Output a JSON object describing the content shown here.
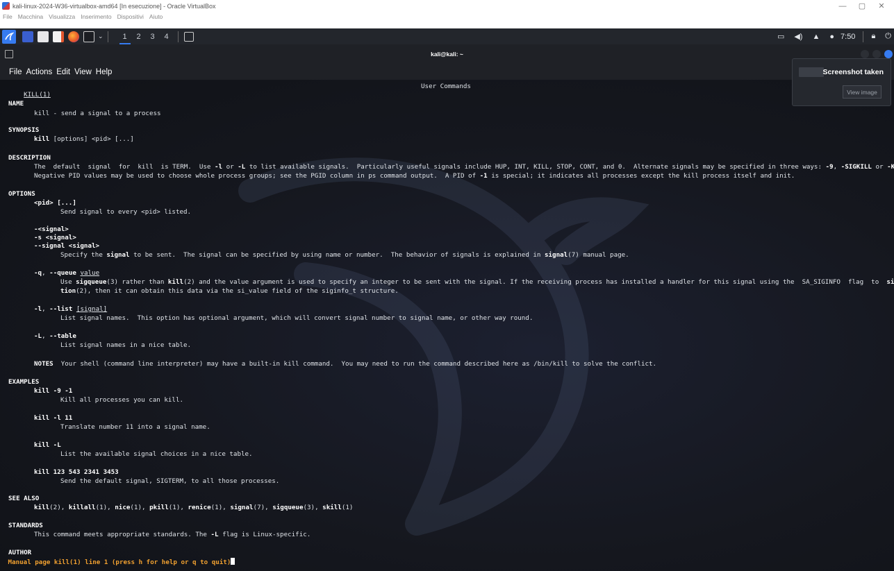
{
  "vbox": {
    "title": "kali-linux-2024-W36-virtualbox-amd64 [In esecuzione] - Oracle VirtualBox",
    "menu": [
      "File",
      "Macchina",
      "Visualizza",
      "Inserimento",
      "Dispositivi",
      "Aiuto"
    ],
    "controls": {
      "minimize": "—",
      "restore": "▢",
      "close": "✕"
    }
  },
  "panel": {
    "workspaces": [
      "1",
      "2",
      "3",
      "4"
    ],
    "active_workspace": "1",
    "clock": "7:50",
    "icons": [
      "kali-menu-icon",
      "terminal-app-icon",
      "file-manager-icon",
      "text-editor-icon",
      "firefox-icon",
      "terminal-icon",
      "window-icon",
      "display-icon",
      "volume-icon",
      "notification-bell-icon",
      "power-icon",
      "lock-icon",
      "logout-icon"
    ]
  },
  "terminal": {
    "title": "kali@kali: ~",
    "menu": [
      "File",
      "Actions",
      "Edit",
      "View",
      "Help"
    ]
  },
  "man": {
    "header_left": "KILL(1)",
    "header_center": "User Commands",
    "name_heading": "NAME",
    "name_text": "kill - send a signal to a process",
    "synopsis_heading": "SYNOPSIS",
    "synopsis_cmd": "kill",
    "synopsis_args": " [options] <pid> [...]",
    "description_heading": "DESCRIPTION",
    "desc_l1_a": "The  default  signal  for  kill  is TERM.  Use ",
    "desc_l1_b": "-l",
    "desc_l1_c": " or ",
    "desc_l1_d": "-L",
    "desc_l1_e": " to list available signals.  Particularly useful signals include HUP, INT, KILL, STOP, CONT, and 0.  Alternate signals may be specified in three ways: ",
    "desc_l1_f": "-9",
    "desc_l1_g": ", ",
    "desc_l1_h": "-SIGKILL",
    "desc_l1_i": " or ",
    "desc_l1_j": "-KILL",
    "desc_l1_k": ".",
    "desc_l2_a": "Negative PID values may be used to choose whole process groups; see the PGID column in ps command output.  A PID of ",
    "desc_l2_b": "-1",
    "desc_l2_c": " is special; it indicates all processes except the kill process itself and init.",
    "options_heading": "OPTIONS",
    "opt_pid": "<pid> [...]",
    "opt_pid_desc": "Send signal to every <pid> listed.",
    "opt_sig1": "-<signal>",
    "opt_sig2": "-s <signal>",
    "opt_sig3": "--signal <signal>",
    "opt_sig_desc_a": "Specify the ",
    "opt_sig_desc_b": "signal",
    "opt_sig_desc_c": " to be sent.  The signal can be specified by using name or number.  The behavior of signals is explained in ",
    "opt_sig_desc_d": "signal",
    "opt_sig_desc_e": "(7) manual page.",
    "opt_q_a": "-q",
    "opt_q_b": ", ",
    "opt_q_c": "--queue",
    "opt_q_d": "value",
    "opt_q_desc1_a": "Use ",
    "opt_q_desc1_b": "sigqueue",
    "opt_q_desc1_c": "(3) rather than ",
    "opt_q_desc1_d": "kill",
    "opt_q_desc1_e": "(2) and the value argument is used to specify an integer to be sent with the signal. If the receiving process has installed a handler for this signal using the  SA_SIGINFO  flag  to  ",
    "opt_q_desc1_f": "sigac-",
    "opt_q_desc2_a": "tion",
    "opt_q_desc2_b": "(2), then it can obtain this data via the si_value field of the siginfo_t structure.",
    "opt_l_a": "-l",
    "opt_l_b": ", ",
    "opt_l_c": "--list",
    "opt_l_d": "[signal]",
    "opt_l_desc": "List signal names.  This option has optional argument, which will convert signal number to signal name, or other way round.",
    "opt_L_a": "-L",
    "opt_L_b": ", ",
    "opt_L_c": "--table",
    "opt_L_desc": "List signal names in a nice table.",
    "notes_label": "NOTES",
    "notes_text": "  Your shell (command line interpreter) may have a built-in kill command.  You may need to run the command described here as /bin/kill to solve the conflict.",
    "examples_heading": "EXAMPLES",
    "ex1_cmd": "kill -9 -1",
    "ex1_desc": "Kill all processes you can kill.",
    "ex2_cmd": "kill -l 11",
    "ex2_desc": "Translate number 11 into a signal name.",
    "ex3_cmd": "kill -L",
    "ex3_desc": "List the available signal choices in a nice table.",
    "ex4_cmd": "kill 123 543 2341 3453",
    "ex4_desc": "Send the default signal, SIGTERM, to all those processes.",
    "seealso_heading": "SEE ALSO",
    "seealso": [
      {
        "name": "kill",
        "sec": "(2)"
      },
      {
        "name": "killall",
        "sec": "(1)"
      },
      {
        "name": "nice",
        "sec": "(1)"
      },
      {
        "name": "pkill",
        "sec": "(1)"
      },
      {
        "name": "renice",
        "sec": "(1)"
      },
      {
        "name": "signal",
        "sec": "(7)"
      },
      {
        "name": "sigqueue",
        "sec": "(3)"
      },
      {
        "name": "skill",
        "sec": "(1)"
      }
    ],
    "standards_heading": "STANDARDS",
    "standards_a": "This command meets appropriate standards. The ",
    "standards_b": "-L",
    "standards_c": " flag is Linux-specific.",
    "author_heading": "AUTHOR",
    "pager_status": " Manual page kill(1) line 1 (press h for help or q to quit)"
  },
  "notification": {
    "title": "Screenshot taken",
    "button": "View image"
  },
  "colors": {
    "accent": "#367bf0",
    "pager": "#f0a030",
    "terminal_bg": "#15171e"
  }
}
